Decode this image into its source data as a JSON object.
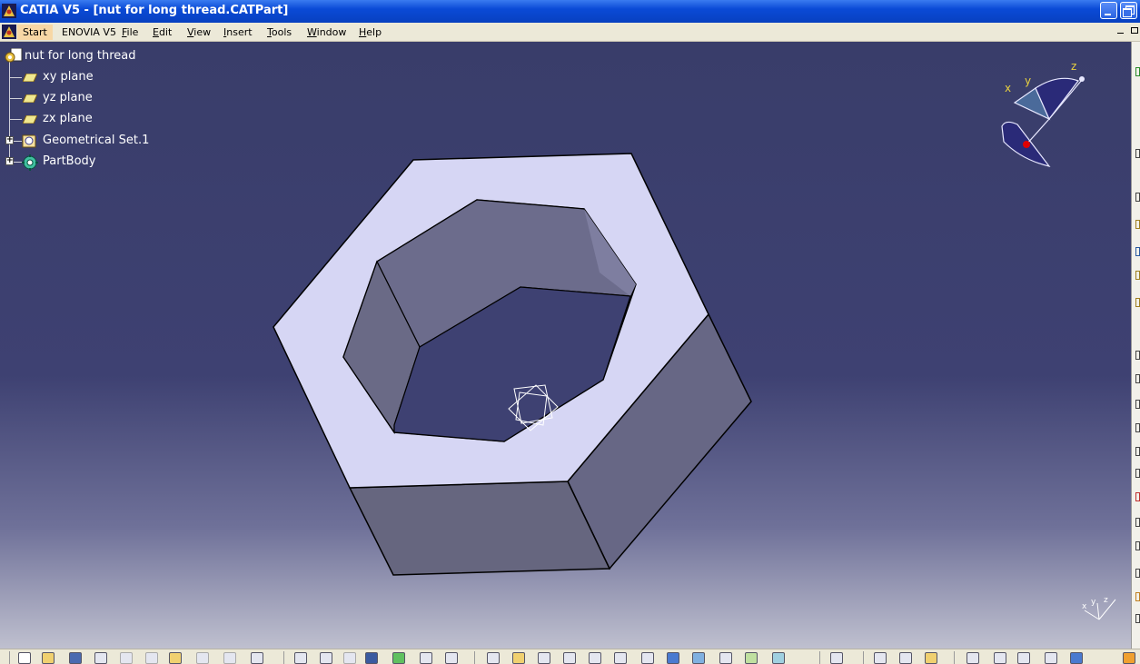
{
  "window": {
    "title": "CATIA V5 - [nut for long thread.CATPart]"
  },
  "menubar": {
    "items": [
      {
        "label": "Start",
        "active": true
      },
      {
        "label": "ENOVIA V5"
      },
      {
        "label": "File"
      },
      {
        "label": "Edit"
      },
      {
        "label": "View"
      },
      {
        "label": "Insert"
      },
      {
        "label": "Tools"
      },
      {
        "label": "Window"
      },
      {
        "label": "Help"
      }
    ]
  },
  "tree": {
    "root": "nut for long thread",
    "children": [
      {
        "label": "xy plane",
        "icon": "plane-icon"
      },
      {
        "label": "yz plane",
        "icon": "plane-icon"
      },
      {
        "label": "zx plane",
        "icon": "plane-icon"
      },
      {
        "label": "Geometrical Set.1",
        "icon": "geometrical-set-icon",
        "expandable": true
      },
      {
        "label": "PartBody",
        "icon": "part-body-icon",
        "expandable": true
      }
    ]
  },
  "compass": {
    "x_label": "x",
    "y_label": "y",
    "z_label": "z"
  },
  "axis_triad": {
    "x_label": "x",
    "y_label": "y",
    "z_label": "z"
  },
  "colors": {
    "viewport_top": "#393d6a",
    "viewport_bottom": "#bfc0cf",
    "nut_top_face": "#d6d6f4",
    "nut_side_face": "#696987",
    "titlebar": "#0a4ad6",
    "menubar": "#ece9d8"
  }
}
